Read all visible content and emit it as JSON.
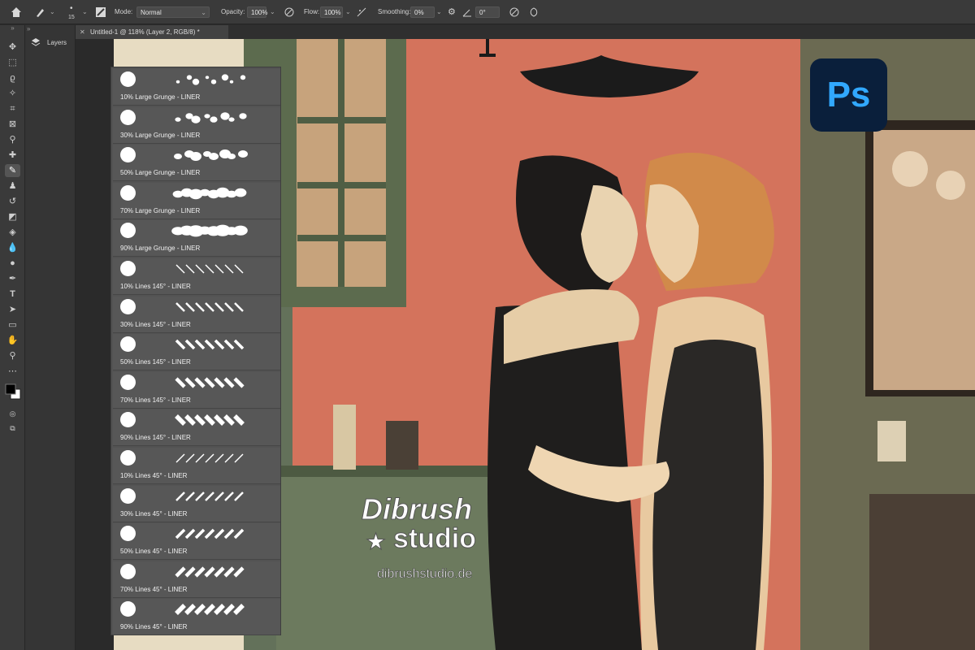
{
  "options_bar": {
    "brush_size": "15",
    "mode_label": "Mode:",
    "mode_value": "Normal",
    "opacity_label": "Opacity:",
    "opacity_value": "100%",
    "flow_label": "Flow:",
    "flow_value": "100%",
    "smoothing_label": "Smoothing:",
    "smoothing_value": "0%",
    "angle_value": "0°"
  },
  "layers_panel": {
    "title": "Layers"
  },
  "document": {
    "tab_title": "Untitled-1 @ 118% (Layer 2, RGB/8) *"
  },
  "brushes": [
    {
      "name": "10% Large Grunge - LINER",
      "pattern": "grunge",
      "level": 0.1
    },
    {
      "name": "30% Large Grunge - LINER",
      "pattern": "grunge",
      "level": 0.3
    },
    {
      "name": "50% Large Grunge - LINER",
      "pattern": "grunge",
      "level": 0.5
    },
    {
      "name": "70% Large Grunge - LINER",
      "pattern": "grunge",
      "level": 0.7
    },
    {
      "name": "90% Large Grunge - LINER",
      "pattern": "grunge",
      "level": 0.9
    },
    {
      "name": "10% Lines 145° - LINER",
      "pattern": "lines145",
      "level": 0.1
    },
    {
      "name": "30% Lines 145° - LINER",
      "pattern": "lines145",
      "level": 0.3
    },
    {
      "name": "50% Lines 145° - LINER",
      "pattern": "lines145",
      "level": 0.5
    },
    {
      "name": "70% Lines 145° - LINER",
      "pattern": "lines145",
      "level": 0.7
    },
    {
      "name": "90% Lines 145° - LINER",
      "pattern": "lines145",
      "level": 0.9
    },
    {
      "name": "10% Lines 45° - LINER",
      "pattern": "lines45",
      "level": 0.1
    },
    {
      "name": "30% Lines 45° - LINER",
      "pattern": "lines45",
      "level": 0.3
    },
    {
      "name": "50% Lines 45° - LINER",
      "pattern": "lines45",
      "level": 0.5
    },
    {
      "name": "70% Lines 45° - LINER",
      "pattern": "lines45",
      "level": 0.7
    },
    {
      "name": "90% Lines 45° - LINER",
      "pattern": "lines45",
      "level": 0.9
    }
  ],
  "badge": {
    "text": "Ps",
    "color": "#31a8ff",
    "background": "#0a1f3b"
  },
  "watermark": {
    "line1": "Dibrush",
    "line2": "studio",
    "url": "dibrushstudio.de"
  },
  "colors": {
    "ui_dark": "#3a3a3a",
    "panel": "#535353",
    "wall": "#d9765f"
  },
  "tools": [
    "move-icon",
    "marquee-icon",
    "lasso-icon",
    "magic-wand-icon",
    "crop-icon",
    "frame-icon",
    "eyedropper-icon",
    "healing-icon",
    "brush-icon",
    "stamp-icon",
    "history-brush-icon",
    "eraser-icon",
    "bucket-icon",
    "blur-icon",
    "dodge-icon",
    "pen-icon",
    "type-icon",
    "path-select-icon",
    "rectangle-icon",
    "hand-icon",
    "zoom-icon",
    "more-icon"
  ]
}
